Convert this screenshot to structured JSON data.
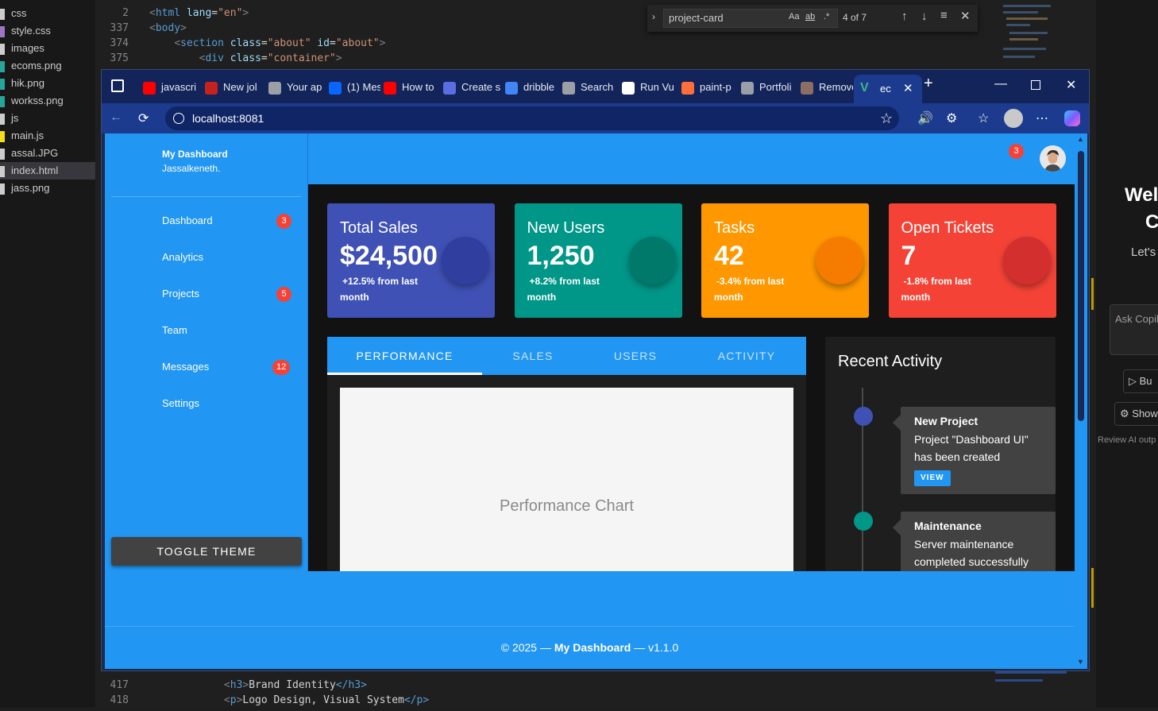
{
  "explorer": {
    "items": [
      {
        "label": "css",
        "color": "#cccccc"
      },
      {
        "label": "style.css",
        "color": "#a074c4"
      },
      {
        "label": "images",
        "color": "#cccccc"
      },
      {
        "label": "ecoms.png",
        "color": "#26a69a"
      },
      {
        "label": "hik.png",
        "color": "#26a69a"
      },
      {
        "label": "workss.png",
        "color": "#26a69a"
      },
      {
        "label": "js",
        "color": "#cccccc"
      },
      {
        "label": "main.js",
        "color": "#f5de19"
      },
      {
        "label": "assal.JPG",
        "color": "#cccccc"
      },
      {
        "label": "index.html",
        "color": "#cccccc"
      },
      {
        "label": "jass.png",
        "color": "#cccccc"
      }
    ],
    "selected": "index.html"
  },
  "editor": {
    "top_lines": [
      {
        "num": "2",
        "open": "<",
        "tag": "html",
        "attr": " lang",
        "eq": "=",
        "val": "\"en\"",
        "close": ">"
      },
      {
        "num": "337",
        "open": "<",
        "tag": "body",
        "attr": "",
        "eq": "",
        "val": "",
        "close": ">"
      },
      {
        "num": "374",
        "open": "<",
        "tag": "section",
        "attr": " class",
        "eq": "=",
        "val": "\"about\"",
        "close": ""
      },
      {
        "num": "375",
        "open": "<",
        "tag": "div",
        "attr": " class",
        "eq": "=",
        "val": "\"container\"",
        "close": ">"
      }
    ],
    "line_374_extra": {
      "attr": " id",
      "eq": "=",
      "val": "\"about\"",
      "close": ">"
    },
    "bottom_lines": [
      {
        "num": "417",
        "open": "<",
        "tag": "h3",
        "text": "Brand Identity",
        "endtag": "</h3>"
      },
      {
        "num": "418",
        "open": "<",
        "tag": "p",
        "text": "Logo Design, Visual System",
        "endtag": "</p>"
      }
    ],
    "find": {
      "query": "project-card",
      "case_label": "Aa",
      "word_label": "ab",
      "regex_label": ".*",
      "count": "4 of 7"
    }
  },
  "copilot_pane": {
    "welcome": "Wel",
    "c": "C",
    "lets": "Let's",
    "ask": "Ask Copil",
    "build": "Bu",
    "show": "Show",
    "review": "Review AI outp"
  },
  "browser": {
    "tabs": [
      {
        "label": "javascri",
        "fav_color": "#ff0000",
        "fav_icon": "youtube-icon"
      },
      {
        "label": "New jol",
        "fav_color": "#c5221f",
        "fav_icon": "gmail-icon"
      },
      {
        "label": "Your ap",
        "fav_color": "#9aa0a6",
        "fav_icon": "info-icon"
      },
      {
        "label": "(1) Mes",
        "fav_color": "#0866ff",
        "fav_icon": "messenger-icon"
      },
      {
        "label": "How to",
        "fav_color": "#ff0000",
        "fav_icon": "youtube-icon"
      },
      {
        "label": "Create s",
        "fav_color": "#5b6ee1",
        "fav_icon": "logo-icon"
      },
      {
        "label": "dribble",
        "fav_color": "#4285f4",
        "fav_icon": "search-icon"
      },
      {
        "label": "Search",
        "fav_color": "#9aa0a6",
        "fav_icon": "google-icon"
      },
      {
        "label": "Run Vu",
        "fav_color": "#ffffff",
        "fav_icon": "openai-icon"
      },
      {
        "label": "paint-p",
        "fav_color": "#ff6f3c",
        "fav_icon": "figma-icon"
      },
      {
        "label": "Portfoli",
        "fav_color": "#9aa0a6",
        "fav_icon": "globe-icon"
      },
      {
        "label": "Remove",
        "fav_color": "#8d6e63",
        "fav_icon": "image-icon"
      }
    ],
    "active_tab": {
      "label": "ec",
      "fav_color": "#41b883",
      "fav_icon": "vue-icon"
    },
    "url": "localhost:8081"
  },
  "dashboard": {
    "brand_title": "My Dashboard",
    "brand_sub": "Jassalkeneth.",
    "nav": [
      {
        "label": "Dashboard",
        "badge": "3"
      },
      {
        "label": "Analytics",
        "badge": ""
      },
      {
        "label": "Projects",
        "badge": "5"
      },
      {
        "label": "Team",
        "badge": ""
      },
      {
        "label": "Messages",
        "badge": "12"
      },
      {
        "label": "Settings",
        "badge": ""
      }
    ],
    "toggle_theme": "TOGGLE THEME",
    "notifications": "3",
    "stats": [
      {
        "title": "Total Sales",
        "value": "$24,500",
        "change": "+12.5% from last month",
        "color": "#3f51b5",
        "circle": "#303f9f"
      },
      {
        "title": "New Users",
        "value": "1,250",
        "change": "+8.2% from last month",
        "color": "#009688",
        "circle": "#00796b"
      },
      {
        "title": "Tasks",
        "value": "42",
        "change": "-3.4% from last month",
        "color": "#ff9800",
        "circle": "#f57c00"
      },
      {
        "title": "Open Tickets",
        "value": "7",
        "change": "-1.8% from last month",
        "color": "#f44336",
        "circle": "#d32f2f"
      }
    ],
    "tabs": [
      "PERFORMANCE",
      "SALES",
      "USERS",
      "ACTIVITY"
    ],
    "chart_placeholder": "Performance Chart",
    "activity_title": "Recent Activity",
    "activity": [
      {
        "title": "New Project",
        "body": "Project \"Dashboard UI\" has been created",
        "action": "VIEW",
        "dot": "#3f51b5"
      },
      {
        "title": "Maintenance",
        "body": "Server maintenance completed successfully",
        "action": "",
        "dot": "#009688"
      }
    ],
    "footer": {
      "year": "© 2025 — ",
      "brand": "My Dashboard",
      "version": " — v1.1.0"
    }
  }
}
